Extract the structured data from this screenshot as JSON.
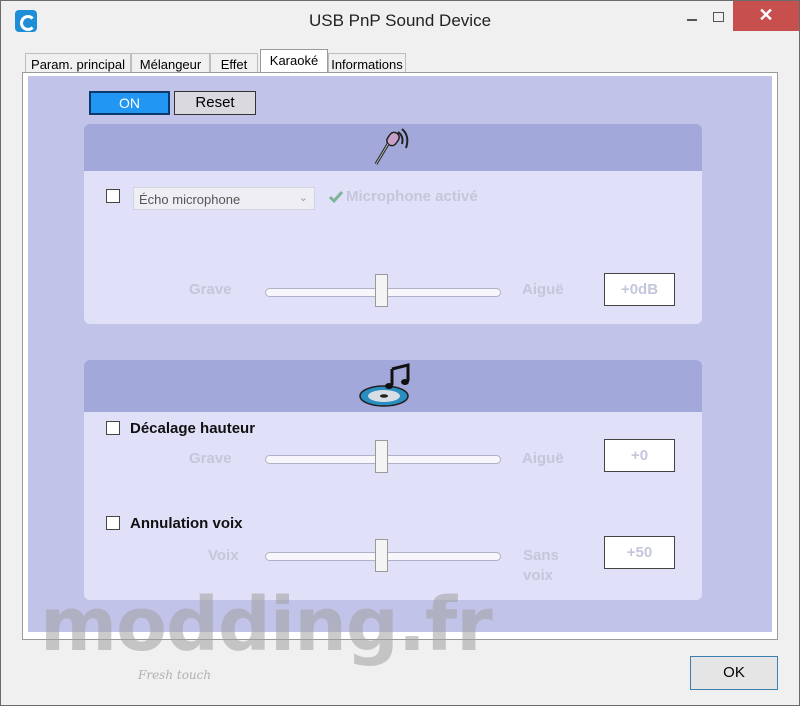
{
  "window": {
    "title": "USB PnP Sound Device",
    "close_glyph": "✕"
  },
  "tabs": [
    {
      "label": "Param. principal",
      "active": false
    },
    {
      "label": "Mélangeur",
      "active": false
    },
    {
      "label": "Effet",
      "active": false
    },
    {
      "label": "Karaoké",
      "active": true
    },
    {
      "label": "Informations",
      "active": false
    }
  ],
  "karaoke": {
    "on_label": "ON",
    "reset_label": "Reset",
    "microphone": {
      "icon": "microphone-icon",
      "checked": false,
      "select_value": "Écho microphone",
      "status_label": "Microphone activé",
      "status_icon": "checkmark-icon",
      "slider_left": "Grave",
      "slider_right": "Aiguë",
      "slider_value": "+0dB",
      "slider_level": 0.5
    },
    "music": {
      "icon": "music-note-disc-icon",
      "pitch": {
        "label": "Décalage hauteur",
        "checked": false,
        "slider_left": "Grave",
        "slider_right": "Aiguë",
        "value": "+0",
        "slider_level": 0.5
      },
      "voice_cancel": {
        "label": "Annulation voix",
        "checked": false,
        "slider_left": "Voix",
        "slider_right_line1": "Sans",
        "slider_right_line2": "voix",
        "value": "+50",
        "slider_level": 0.5
      }
    }
  },
  "footer": {
    "ok_label": "OK"
  },
  "watermark": {
    "text": "modding.fr",
    "sub": "Fresh touch"
  },
  "colors": {
    "accent": "#2196f3",
    "close": "#c7504f",
    "panel_bg": "#c2c3e8",
    "section_head": "#a2a8da"
  }
}
